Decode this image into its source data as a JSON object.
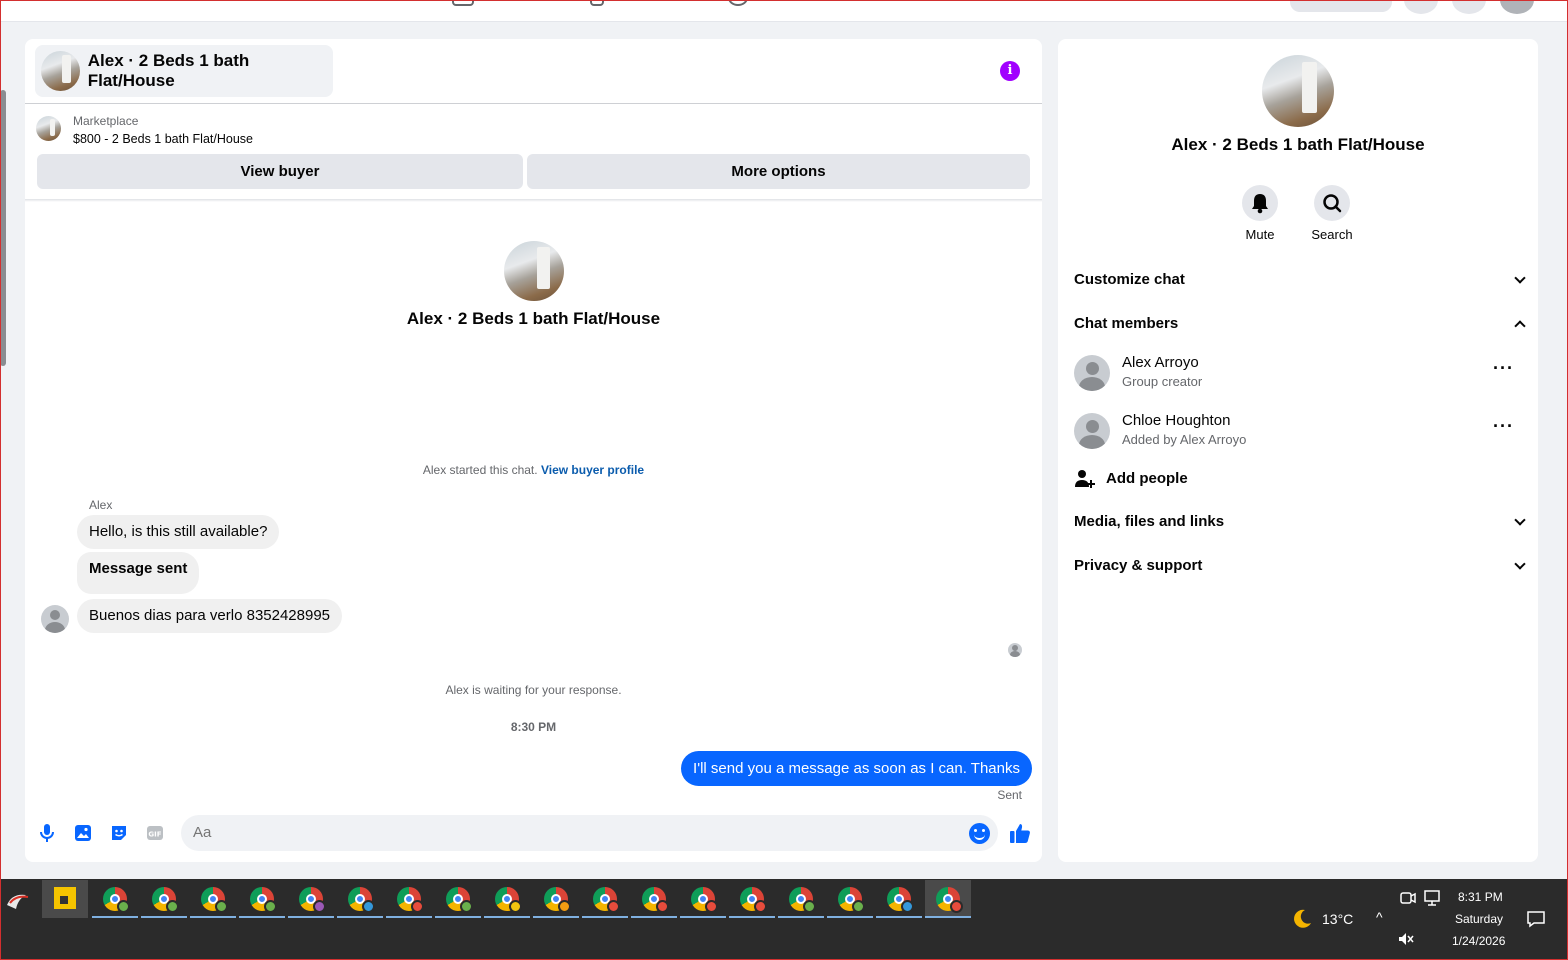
{
  "chat_header": {
    "title": "Alex · 2 Beds 1 bath Flat/House",
    "info_icon": "i"
  },
  "listing": {
    "label": "Marketplace",
    "price_title": "$800 - 2 Beds 1 bath Flat/House"
  },
  "actions": {
    "view_buyer": "View buyer",
    "more_options": "More options"
  },
  "conversation": {
    "title": "Alex · 2 Beds 1 bath Flat/House",
    "started_text": "Alex started this chat.",
    "started_link": "View buyer profile",
    "sender_name": "Alex",
    "incoming": [
      "Hello, is this still available?",
      "Message sent",
      "Buenos dias para verlo  8352428995"
    ],
    "waiting_text": "Alex is waiting for your response.",
    "timestamp": "8:30 PM",
    "outgoing": "I'll send you a message as soon as I can. Thanks",
    "status": "Sent"
  },
  "composer": {
    "placeholder": "Aa",
    "icons": [
      "microphone-icon",
      "photo-icon",
      "sticker-icon",
      "gif-icon",
      "emoji-icon",
      "thumbs-up-icon"
    ],
    "accent": "#0866ff"
  },
  "side_panel": {
    "title": "Alex · 2 Beds 1 bath Flat/House",
    "mute_label": "Mute",
    "search_label": "Search",
    "customize_chat": "Customize chat",
    "chat_members": "Chat members",
    "members": [
      {
        "name": "Alex Arroyo",
        "sub": "Group creator"
      },
      {
        "name": "Chloe Houghton",
        "sub": "Added by Alex Arroyo"
      }
    ],
    "add_people": "Add people",
    "media": "Media, files and links",
    "privacy": "Privacy & support"
  },
  "taskbar": {
    "weather": "13°C",
    "time": "8:31 PM",
    "day": "Saturday",
    "date": "1/24/2026",
    "profile_colors": [
      "#6ab04c",
      "#6ab04c",
      "#6ab04c",
      "#6ab04c",
      "#9b59b6",
      "#3498db",
      "#e74c3c",
      "#6ab04c",
      "#f1c40f",
      "#f39c12",
      "#e74c3c",
      "#e74c3c",
      "#e74c3c",
      "#e74c3c",
      "#6ab04c",
      "#6ab04c",
      "#3498db",
      "#e74c3c"
    ]
  }
}
